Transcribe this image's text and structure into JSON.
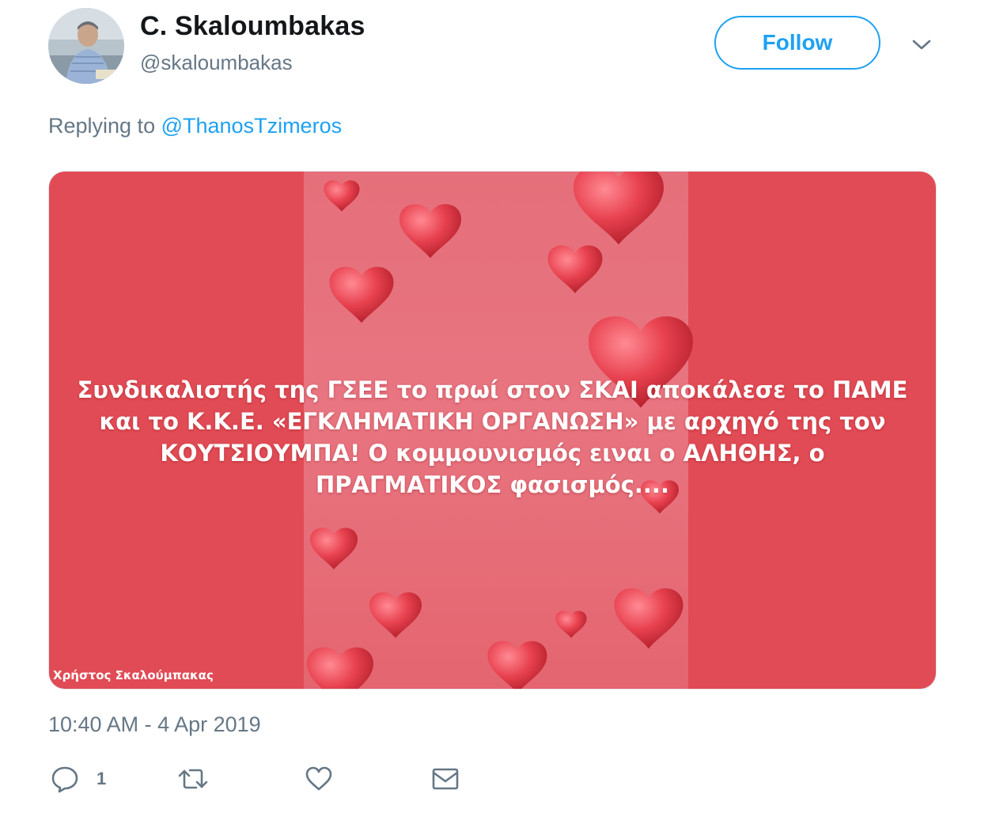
{
  "author": {
    "display_name": "C. Skaloumbakas",
    "handle": "@skaloumbakas",
    "avatar": "profile-photo"
  },
  "follow_label": "Follow",
  "reply_context": {
    "prefix": "Replying to",
    "mention": "@ThanosTzimeros"
  },
  "media": {
    "overlay_lines": [
      "Συνδικαλιστής της ΓΣΕΕ το πρωί στον ΣΚΑΙ αποκάλεσε το ΠΑΜΕ",
      "και το Κ.Κ.Ε. «ΕΓΚΛΗΜΑΤΙΚΗ ΟΡΓΑΝΩΣΗ» με αρχηγό της τον",
      "ΚΟΥΤΣΙΟΥΜΠΑ! Ο κομμουνισμός ειναι ο ΑΛΗΘΗΣ, ο",
      "ΠΡΑΓΜΑΤΙΚΟΣ φασισμός...."
    ],
    "watermark": "Χρήστος Σκαλούμπακας",
    "background": "red-hearts",
    "colors": {
      "side": "#e14b55",
      "center": "#e87581",
      "heart": "#e63f4d"
    }
  },
  "timestamp": "10:40 AM - 4 Apr 2019",
  "actions": {
    "reply": {
      "icon": "reply-icon",
      "count": "1"
    },
    "retweet": {
      "icon": "retweet-icon"
    },
    "like": {
      "icon": "heart-icon"
    },
    "dm": {
      "icon": "envelope-icon"
    }
  },
  "colors": {
    "accent": "#1da1f2",
    "secondary_text": "#657786",
    "primary_text": "#14171a"
  }
}
